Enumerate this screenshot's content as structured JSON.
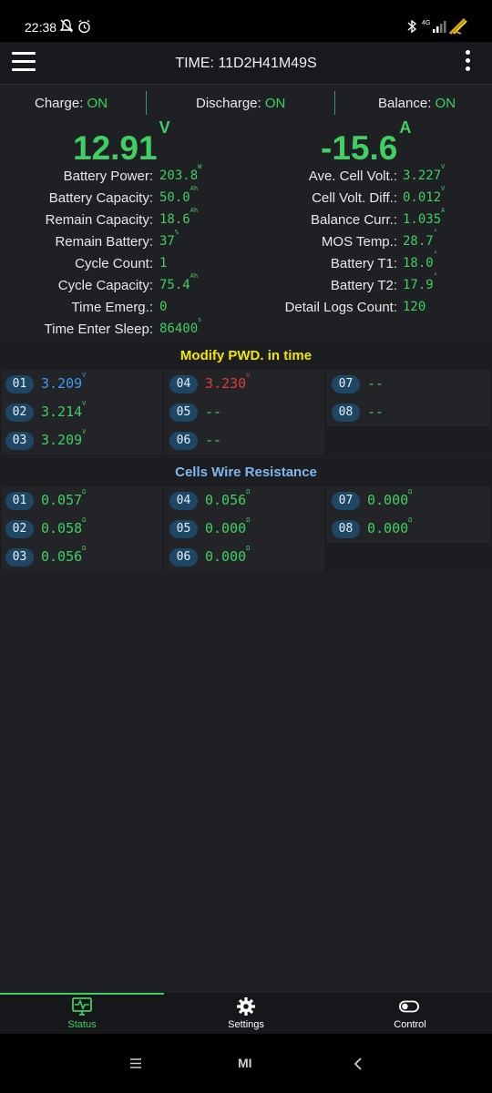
{
  "status_bar": {
    "time": "22:38",
    "net_label": "4G"
  },
  "app_bar": {
    "title": "TIME: 11D2H41M49S"
  },
  "switches": {
    "charge_label": "Charge:",
    "charge_value": "ON",
    "discharge_label": "Discharge:",
    "discharge_value": "ON",
    "balance_label": "Balance:",
    "balance_value": "ON"
  },
  "main": {
    "voltage": "12.91",
    "voltage_unit": "V",
    "current": "-15.6",
    "current_unit": "A"
  },
  "left_stats": [
    {
      "label": "Battery Power:",
      "value": "203.8",
      "unit": "W"
    },
    {
      "label": "Battery Capacity:",
      "value": "50.0",
      "unit": "Ah"
    },
    {
      "label": "Remain Capacity:",
      "value": "18.6",
      "unit": "Ah"
    },
    {
      "label": "Remain Battery:",
      "value": "37",
      "unit": "%"
    },
    {
      "label": "Cycle Count:",
      "value": "1",
      "unit": ""
    },
    {
      "label": "Cycle Capacity:",
      "value": "75.4",
      "unit": "Ah"
    },
    {
      "label": "Time Emerg.:",
      "value": "0",
      "unit": ""
    },
    {
      "label": "Time Enter Sleep:",
      "value": "86400",
      "unit": "s"
    }
  ],
  "right_stats": [
    {
      "label": "Ave. Cell Volt.:",
      "value": "3.227",
      "unit": "V"
    },
    {
      "label": "Cell Volt. Diff.:",
      "value": "0.012",
      "unit": "V"
    },
    {
      "label": "Balance Curr.:",
      "value": "1.035",
      "unit": "A"
    },
    {
      "label": "MOS Temp.:",
      "value": "28.7",
      "unit": "°"
    },
    {
      "label": "Battery T1:",
      "value": "18.0",
      "unit": "°"
    },
    {
      "label": "Battery T2:",
      "value": "17.9",
      "unit": "°"
    },
    {
      "label": "Detail Logs Count:",
      "value": "120",
      "unit": ""
    }
  ],
  "cells_section": {
    "title": "Modify PWD. in time",
    "title_color": "#f2e600",
    "cells": [
      {
        "id": "01",
        "value": "3.209",
        "unit": "V",
        "color": "#3d9bf0"
      },
      {
        "id": "02",
        "value": "3.214",
        "unit": "V",
        "color": "#3fcf62"
      },
      {
        "id": "03",
        "value": "3.209",
        "unit": "V",
        "color": "#3fcf62"
      },
      {
        "id": "04",
        "value": "3.230",
        "unit": "V",
        "color": "#e23b3b"
      },
      {
        "id": "05",
        "value": "--",
        "unit": "",
        "color": "#3fcf62"
      },
      {
        "id": "06",
        "value": "--",
        "unit": "",
        "color": "#3fcf62"
      },
      {
        "id": "07",
        "value": "--",
        "unit": "",
        "color": "#3fcf62"
      },
      {
        "id": "08",
        "value": "--",
        "unit": "",
        "color": "#3fcf62"
      }
    ]
  },
  "resistance_section": {
    "title": "Cells Wire Resistance",
    "title_color": "#7fb6ee",
    "cells": [
      {
        "id": "01",
        "value": "0.057",
        "unit": "Ω",
        "color": "#3fcf62"
      },
      {
        "id": "02",
        "value": "0.058",
        "unit": "Ω",
        "color": "#3fcf62"
      },
      {
        "id": "03",
        "value": "0.056",
        "unit": "Ω",
        "color": "#3fcf62"
      },
      {
        "id": "04",
        "value": "0.056",
        "unit": "Ω",
        "color": "#3fcf62"
      },
      {
        "id": "05",
        "value": "0.000",
        "unit": "Ω",
        "color": "#3fcf62"
      },
      {
        "id": "06",
        "value": "0.000",
        "unit": "Ω",
        "color": "#3fcf62"
      },
      {
        "id": "07",
        "value": "0.000",
        "unit": "Ω",
        "color": "#3fcf62"
      },
      {
        "id": "08",
        "value": "0.000",
        "unit": "Ω",
        "color": "#3fcf62"
      }
    ]
  },
  "bottom_nav": {
    "items": [
      {
        "label": "Status",
        "icon": "monitor-pulse-icon",
        "active": true
      },
      {
        "label": "Settings",
        "icon": "gear-icon",
        "active": false
      },
      {
        "label": "Control",
        "icon": "toggle-icon",
        "active": false
      }
    ]
  },
  "system_nav": {
    "brand": "MI"
  },
  "colors": {
    "accent": "#3fcf62",
    "background": "#1f2023"
  }
}
